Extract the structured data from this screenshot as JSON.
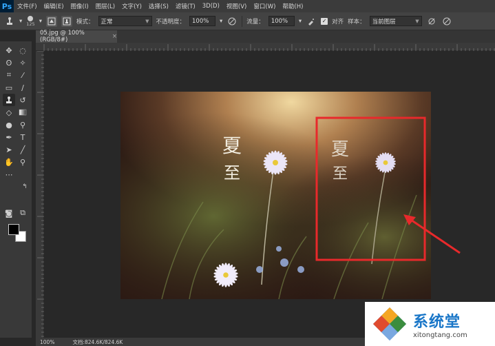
{
  "app": {
    "logo": "Ps"
  },
  "menu": [
    "文件(F)",
    "编辑(E)",
    "图像(I)",
    "图层(L)",
    "文字(Y)",
    "选择(S)",
    "滤镜(T)",
    "3D(D)",
    "视图(V)",
    "窗口(W)",
    "帮助(H)"
  ],
  "options": {
    "brush_size": "125",
    "mode_label": "模式：",
    "mode_value": "正常",
    "opacity_label": "不透明度：",
    "opacity_value": "100%",
    "flow_label": "流量：",
    "flow_value": "100%",
    "aligned_label": "对齐",
    "sample_label": "样本：",
    "sample_value": "当前图层"
  },
  "document_tab": {
    "title": "05.jpg @ 100%(RGB/8#)",
    "close_glyph": "×"
  },
  "status": {
    "zoom": "100%",
    "doc_info": "文档:824.6K/824.6K"
  },
  "image_text": {
    "line1": "夏",
    "line2": "至"
  },
  "watermark": {
    "brand": "系统堂",
    "url": "xitongtang.com"
  },
  "colors": {
    "accent": "#31a8ff",
    "annotation": "#e8292b",
    "canvas_bg": "#282828",
    "brand_text": "#1976c8"
  }
}
